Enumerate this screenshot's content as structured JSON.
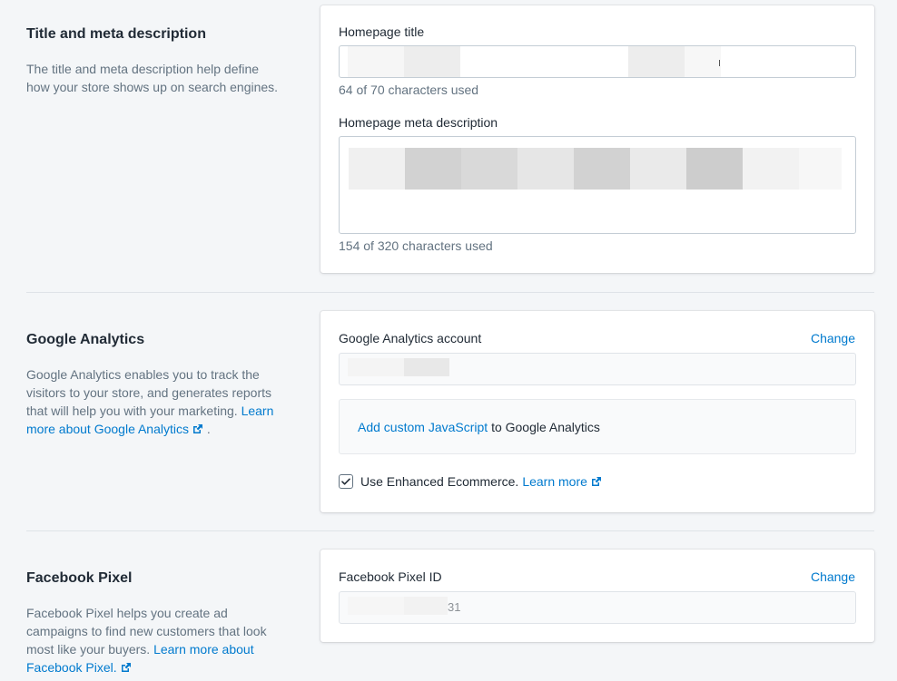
{
  "title_meta": {
    "heading": "Title and meta description",
    "description": "The title and meta description help define how your store shows up on search engines.",
    "homepage_title_label": "Homepage title",
    "homepage_title_count": "64 of 70 characters used",
    "meta_description_label": "Homepage meta description",
    "meta_description_count": "154 of 320 characters used"
  },
  "google_analytics": {
    "heading": "Google Analytics",
    "description": "Google Analytics enables you to track the visitors to your store, and generates reports that will help you with your marketing.",
    "learn_more_link": "Learn more about Google Analytics",
    "trailing_period": ".",
    "account_label": "Google Analytics account",
    "change_label": "Change",
    "custom_js_link": "Add custom JavaScript",
    "custom_js_suffix": "to Google Analytics",
    "enhanced_ecommerce_label": "Use Enhanced Ecommerce.",
    "enhanced_ecommerce_checked": true,
    "enhanced_learn_more": "Learn more"
  },
  "facebook_pixel": {
    "heading": "Facebook Pixel",
    "description": "Facebook Pixel helps you create ad campaigns to find new customers that look most like your buyers.",
    "learn_more_link": "Learn more about Facebook Pixel.",
    "pixel_id_label": "Facebook Pixel ID",
    "change_label": "Change",
    "pixel_id_visible_fragment": "31"
  },
  "colors": {
    "link": "#007ace",
    "text": "#212b36",
    "subdued": "#637381",
    "background": "#f4f6f8"
  }
}
